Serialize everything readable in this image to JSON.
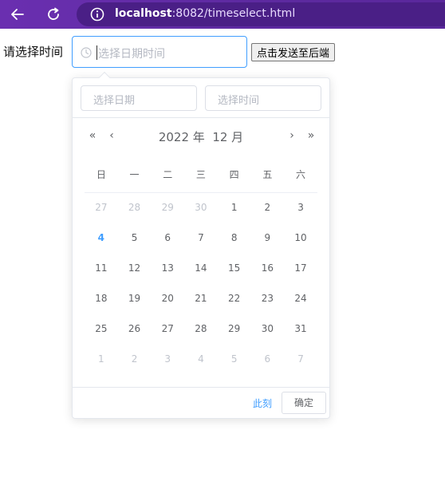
{
  "browser": {
    "url_host": "localhost",
    "url_rest": ":8082/timeselect.html"
  },
  "form": {
    "prompt_label": "请选择时间",
    "datetime_placeholder": "选择日期时间",
    "send_button": "点击发送至后端"
  },
  "picker": {
    "date_placeholder": "选择日期",
    "time_placeholder": "选择时间",
    "prev_year": "«",
    "prev_month": "‹",
    "next_month": "›",
    "next_year": "»",
    "year_label": "2022 年",
    "month_label": "12 月",
    "weekdays": [
      "日",
      "一",
      "二",
      "三",
      "四",
      "五",
      "六"
    ],
    "weeks": [
      [
        {
          "d": "27",
          "t": "other"
        },
        {
          "d": "28",
          "t": "other"
        },
        {
          "d": "29",
          "t": "other"
        },
        {
          "d": "30",
          "t": "other"
        },
        {
          "d": "1",
          "t": "cur"
        },
        {
          "d": "2",
          "t": "cur"
        },
        {
          "d": "3",
          "t": "cur"
        }
      ],
      [
        {
          "d": "4",
          "t": "today"
        },
        {
          "d": "5",
          "t": "cur"
        },
        {
          "d": "6",
          "t": "cur"
        },
        {
          "d": "7",
          "t": "cur"
        },
        {
          "d": "8",
          "t": "cur"
        },
        {
          "d": "9",
          "t": "cur"
        },
        {
          "d": "10",
          "t": "cur"
        }
      ],
      [
        {
          "d": "11",
          "t": "cur"
        },
        {
          "d": "12",
          "t": "cur"
        },
        {
          "d": "13",
          "t": "cur"
        },
        {
          "d": "14",
          "t": "cur"
        },
        {
          "d": "15",
          "t": "cur"
        },
        {
          "d": "16",
          "t": "cur"
        },
        {
          "d": "17",
          "t": "cur"
        }
      ],
      [
        {
          "d": "18",
          "t": "cur"
        },
        {
          "d": "19",
          "t": "cur"
        },
        {
          "d": "20",
          "t": "cur"
        },
        {
          "d": "21",
          "t": "cur"
        },
        {
          "d": "22",
          "t": "cur"
        },
        {
          "d": "23",
          "t": "cur"
        },
        {
          "d": "24",
          "t": "cur"
        }
      ],
      [
        {
          "d": "25",
          "t": "cur"
        },
        {
          "d": "26",
          "t": "cur"
        },
        {
          "d": "27",
          "t": "cur"
        },
        {
          "d": "28",
          "t": "cur"
        },
        {
          "d": "29",
          "t": "cur"
        },
        {
          "d": "30",
          "t": "cur"
        },
        {
          "d": "31",
          "t": "cur"
        }
      ],
      [
        {
          "d": "1",
          "t": "other"
        },
        {
          "d": "2",
          "t": "other"
        },
        {
          "d": "3",
          "t": "other"
        },
        {
          "d": "4",
          "t": "other"
        },
        {
          "d": "5",
          "t": "other"
        },
        {
          "d": "6",
          "t": "other"
        },
        {
          "d": "7",
          "t": "other"
        }
      ]
    ],
    "now_link": "此刻",
    "confirm_button": "确定"
  },
  "colors": {
    "accent": "#409eff",
    "browser_bar": "#5d2aa0"
  },
  "icons": {
    "back": "arrow-left-icon",
    "reload": "reload-icon",
    "site_info": "info-icon",
    "clock": "clock-icon"
  }
}
